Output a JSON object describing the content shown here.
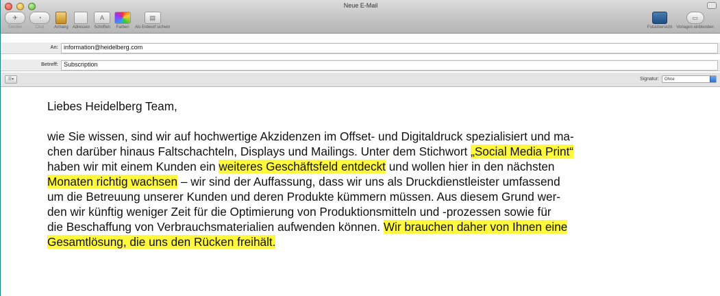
{
  "window": {
    "title": "Neue E-Mail"
  },
  "toolbar": {
    "left": [
      {
        "name": "send",
        "label": "Senden",
        "dim": true
      },
      {
        "name": "chat",
        "label": "Chat",
        "dim": true
      },
      {
        "name": "attach",
        "label": "Anhang",
        "dim": false
      },
      {
        "name": "address",
        "label": "Adressen",
        "dim": false
      },
      {
        "name": "fonts",
        "label": "Schriften",
        "dim": false
      },
      {
        "name": "colors",
        "label": "Farben",
        "dim": false
      },
      {
        "name": "draft",
        "label": "Als Entwurf sichern",
        "dim": false
      }
    ],
    "right": [
      {
        "name": "photo",
        "label": "Fotoübersicht",
        "dim": false
      },
      {
        "name": "templates",
        "label": "Vorlagen einblenden",
        "dim": false
      }
    ]
  },
  "header": {
    "to_label": "An:",
    "to_value": "information@heidelberg.com",
    "subject_label": "Betreff:",
    "subject_value": "Subscription"
  },
  "options": {
    "signature_label": "Signatur:",
    "signature_value": "Ohne"
  },
  "message": {
    "greeting": "Liebes Heidelberg Team,",
    "paragraph": [
      {
        "text": "wie Sie wissen, sind wir auf hochwertige Akzidenzen im Offset- und Digitaldruck spezialisiert und ma-",
        "highlight": false
      },
      {
        "text": "chen darüber hinaus Faltschachteln, Displays und Mailings. Unter dem Stichwort ",
        "highlight": false
      },
      {
        "text": "„Social Media Print“",
        "highlight": true
      },
      {
        "text": "haben wir mit einem Kunden ein ",
        "highlight": false
      },
      {
        "text": "weiteres Geschäftsfeld entdeckt",
        "highlight": true
      },
      {
        "text": " und wollen hier in den nächsten",
        "highlight": false
      },
      {
        "text": "Monaten richtig wachsen",
        "highlight": true
      },
      {
        "text": " – wir sind der Auffassung, dass wir uns als Druckdienstleister umfassend",
        "highlight": false
      },
      {
        "text": "um die Betreuung unserer Kunden und deren Produkte kümmern müssen. Aus diesem Grund wer-",
        "highlight": false
      },
      {
        "text": "den wir künftig weniger Zeit für die Optimierung von Produktionsmitteln und -prozessen sowie für",
        "highlight": false
      },
      {
        "text": "die Beschaffung von Verbrauchsmaterialien aufwenden können. ",
        "highlight": false
      },
      {
        "text": "Wir brauchen daher von Ihnen eine",
        "highlight": true
      },
      {
        "text": "Gesamtlösung, die uns den Rücken freihält.",
        "highlight": true
      }
    ]
  },
  "colors": {
    "highlight": "#fff83d",
    "frame": "#2b8c8f"
  }
}
